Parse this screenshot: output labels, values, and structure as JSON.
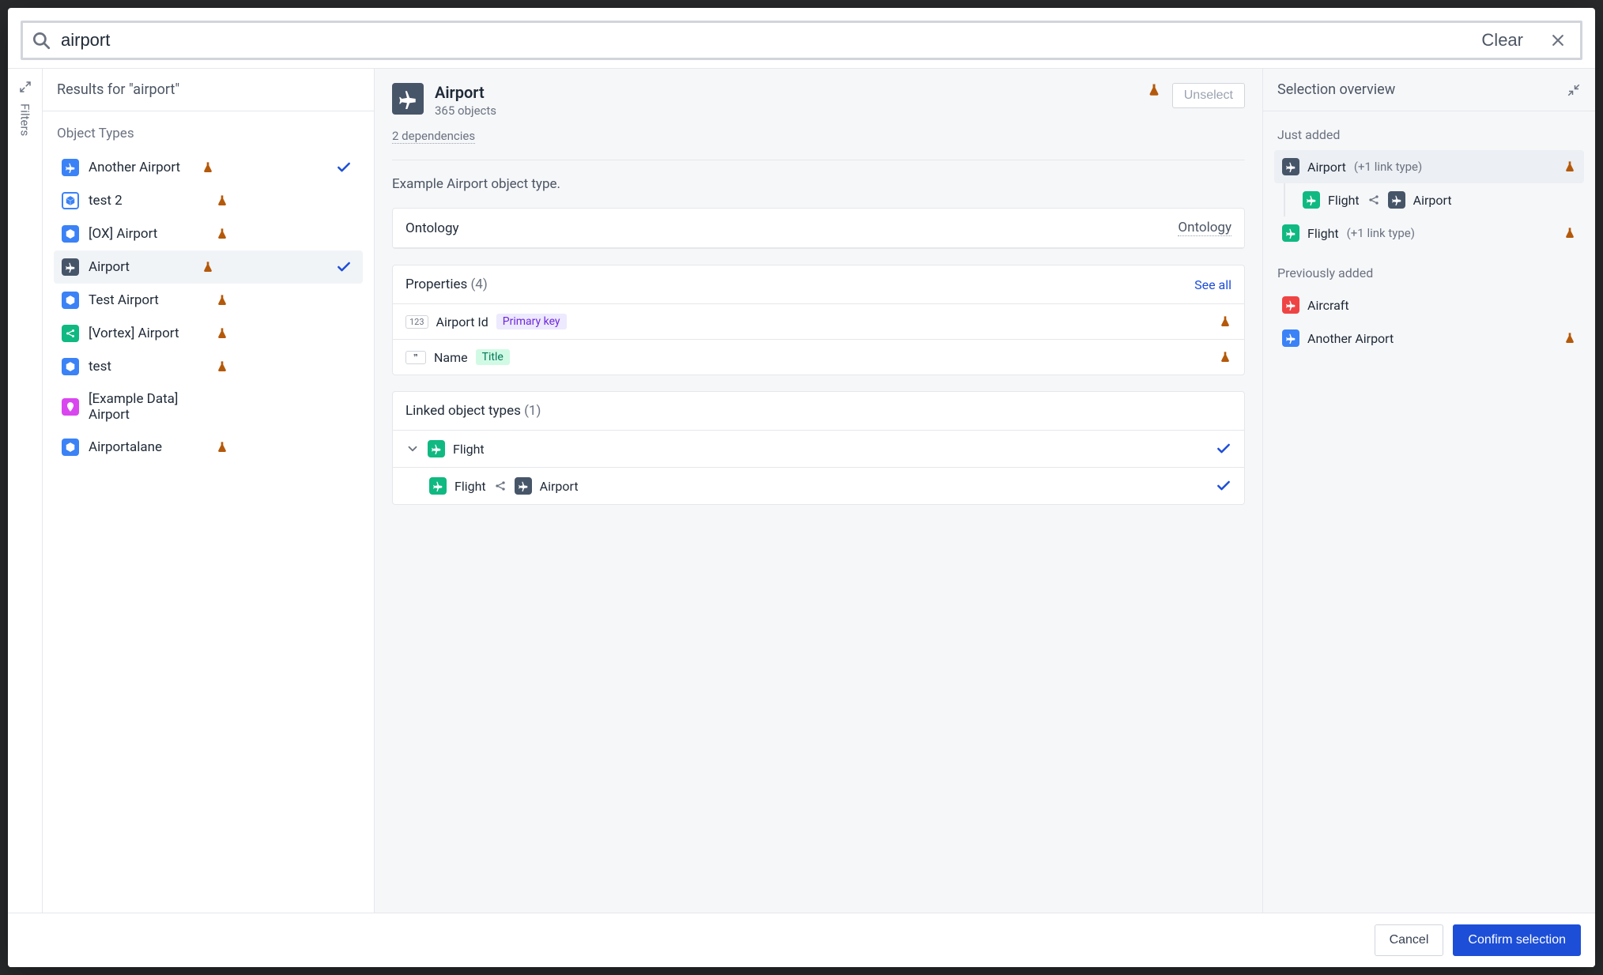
{
  "search": {
    "value": "airport",
    "clear": "Clear"
  },
  "filters_rail": {
    "label": "Filters"
  },
  "results": {
    "header": "Results for \"airport\"",
    "section": "Object Types",
    "items": [
      {
        "label": "Another Airport",
        "icon": "plane",
        "icon_bg": "blue",
        "flask": true,
        "checked": true
      },
      {
        "label": "test 2",
        "icon": "cube",
        "icon_bg": "skyout",
        "flask": true,
        "checked": false
      },
      {
        "label": "[OX] Airport",
        "icon": "cube",
        "icon_bg": "blue",
        "flask": true,
        "checked": false
      },
      {
        "label": "Airport",
        "icon": "plane",
        "icon_bg": "slate",
        "flask": true,
        "checked": true,
        "selected": true
      },
      {
        "label": "Test Airport",
        "icon": "cube",
        "icon_bg": "blue",
        "flask": true,
        "checked": false
      },
      {
        "label": "[Vortex] Airport",
        "icon": "share",
        "icon_bg": "teal",
        "flask": true,
        "checked": false
      },
      {
        "label": "test",
        "icon": "cube",
        "icon_bg": "blue",
        "flask": true,
        "checked": false
      },
      {
        "label": "[Example Data] Airport",
        "icon": "pin",
        "icon_bg": "pink",
        "flask": false,
        "checked": false
      },
      {
        "label": "Airportalane",
        "icon": "cube",
        "icon_bg": "blue",
        "flask": true,
        "checked": false
      }
    ]
  },
  "detail": {
    "title": "Airport",
    "subtitle": "365 objects",
    "unselect": "Unselect",
    "dependencies": "2 dependencies",
    "description": "Example Airport object type.",
    "ontology_card": {
      "label": "Ontology",
      "value": "Ontology"
    },
    "properties": {
      "label": "Properties",
      "count": "(4)",
      "see_all": "See all",
      "rows": [
        {
          "type_chip": "123",
          "name": "Airport Id",
          "tag": "Primary key",
          "tag_class": "pk",
          "flask": true
        },
        {
          "type_chip": "❞",
          "name": "Name",
          "tag": "Title",
          "tag_class": "title",
          "flask": true
        }
      ]
    },
    "linked": {
      "label": "Linked object types",
      "count": "(1)",
      "parent": {
        "label": "Flight"
      },
      "child": {
        "a": "Flight",
        "b": "Airport"
      }
    }
  },
  "selection": {
    "header": "Selection overview",
    "just_added": {
      "label": "Just added",
      "rows": [
        {
          "label": "Airport",
          "meta": "(+1 link type)",
          "icon_bg": "slate",
          "flask": true,
          "hl": true,
          "child": {
            "a": "Flight",
            "a_bg": "teal",
            "b": "Airport",
            "b_bg": "slate"
          }
        },
        {
          "label": "Flight",
          "meta": "(+1 link type)",
          "icon_bg": "teal",
          "flask": true
        }
      ]
    },
    "previously_added": {
      "label": "Previously added",
      "rows": [
        {
          "label": "Aircraft",
          "icon_bg": "red",
          "flask": false
        },
        {
          "label": "Another Airport",
          "icon_bg": "blue",
          "flask": true
        }
      ]
    }
  },
  "footer": {
    "cancel": "Cancel",
    "confirm": "Confirm selection"
  }
}
